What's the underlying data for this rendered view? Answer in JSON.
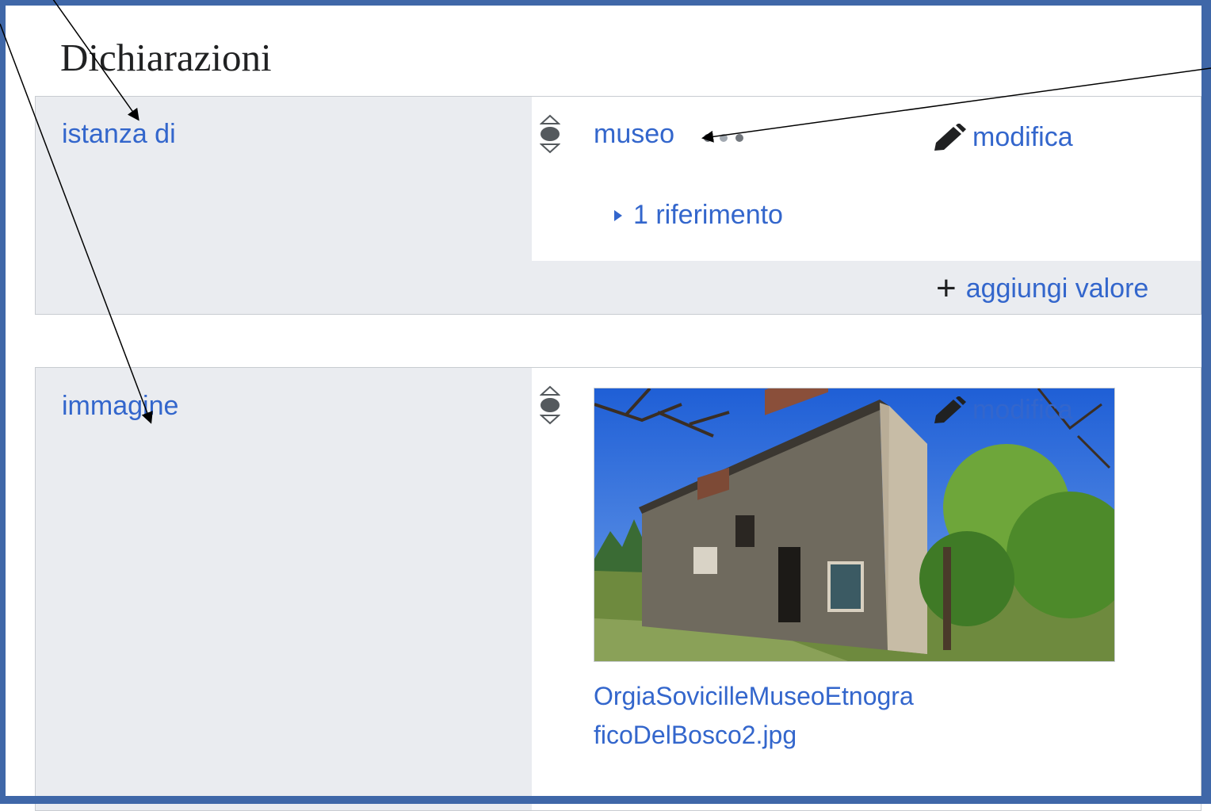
{
  "heading": "Dichiarazioni",
  "statements": [
    {
      "property": "istanza di",
      "value": "museo",
      "edit_label": "modifica",
      "references_label": "1 riferimento",
      "add_value_label": "aggiungi valore"
    },
    {
      "property": "immagine",
      "edit_label": "modifica",
      "file_name": "OrgiaSovicilleMuseoEtnograficoDelBosco2.jpg"
    }
  ],
  "colors": {
    "link": "#3366cc",
    "property_background": "#eaecf0",
    "frame_border": "#3f67a8",
    "text": "#202122"
  },
  "icons": [
    "rank-normal-icon",
    "pencil-icon",
    "expand-triangle-icon",
    "plus-icon",
    "more-dots-icon"
  ]
}
